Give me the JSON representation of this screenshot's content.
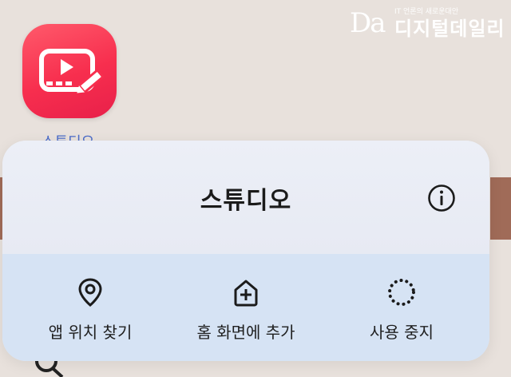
{
  "watermark": {
    "logo": "Da",
    "tagline": "IT 언론의 새로운대안",
    "name": "디지털데일리"
  },
  "app": {
    "label": "스튜디오",
    "icon": "video-edit-icon",
    "accent": "#f72e4e"
  },
  "popup": {
    "title": "스튜디오",
    "info_icon": "info-icon",
    "actions": [
      {
        "label": "앱 위치 찾기",
        "icon": "location-pin-icon"
      },
      {
        "label": "홈 화면에 추가",
        "icon": "home-add-icon"
      },
      {
        "label": "사용 중지",
        "icon": "dotted-circle-icon"
      }
    ]
  }
}
